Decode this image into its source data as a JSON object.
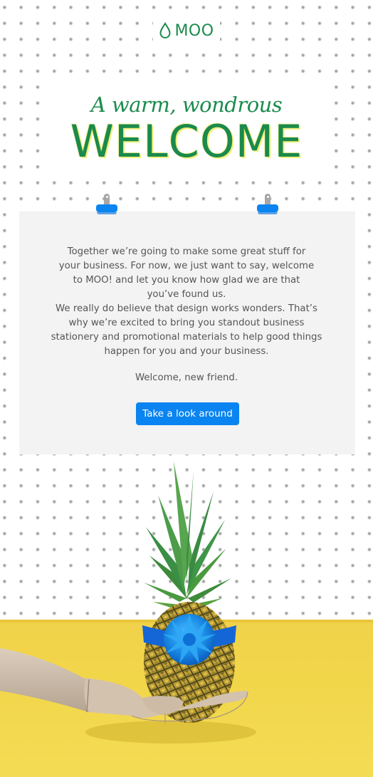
{
  "brand": {
    "logo_text": "MOO",
    "logo_icon": "droplet-icon",
    "primary_green": "#1b8a4c",
    "accent_blue": "#0a84f0",
    "highlight_yellow": "#f2f07a"
  },
  "hero": {
    "script_line": "A warm, wondrous",
    "title": "WELCOME"
  },
  "card": {
    "clips": [
      "binder-clip-icon",
      "binder-clip-icon"
    ],
    "paragraph_1": "Together we’re going to make some great stuff for your business. For now, we just want to say, welcome to MOO! and let you know how glad we are that you’ve found us.",
    "paragraph_2": "We really do believe that design works wonders. That’s why we’re excited to bring you standout business stationery and promotional materials to help good things happen for you and your business.",
    "paragraph_3": "Welcome, new friend.",
    "cta_label": "Take a look around"
  },
  "image": {
    "description": "Wooden mannequin hand holding a pineapple wrapped with a blue ribbon and gift bow on a yellow surface against a pegboard wall",
    "background_color": "#f2d64a"
  }
}
